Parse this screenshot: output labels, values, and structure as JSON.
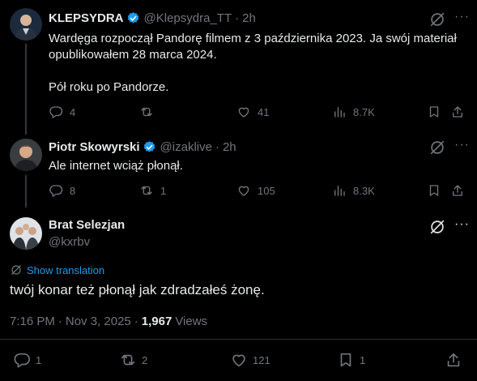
{
  "tweets": [
    {
      "name": "KLEPSYDRA",
      "handle": "@Klepsydra_TT",
      "time": "2h",
      "lines": [
        "Wardęga rozpoczął Pandorę filmem z 3 października 2023. Ja swój materiał",
        "opublikowałem 28 marca 2024."
      ],
      "line3": "Pół roku po Pandorze.",
      "replies": "4",
      "reposts": "",
      "likes": "41",
      "views": "8.7K"
    },
    {
      "name": "Piotr Skowyrski",
      "handle": "@izaklive",
      "time": "2h",
      "text": "Ale internet wciąż płonął.",
      "replies": "8",
      "reposts": "1",
      "likes": "105",
      "views": "8.3K"
    }
  ],
  "main": {
    "name": "Brat Selezjan",
    "handle": "@kxrbv",
    "translate_label": "Show translation",
    "text": "twój konar też płonął jak zdradzałeś żonę.",
    "time": "7:16 PM",
    "date": "Nov 3, 2025",
    "views_count": "1,967",
    "views_label": "Views",
    "replies": "1",
    "reposts": "2",
    "likes": "121",
    "bookmarks": "1"
  },
  "separator_dot": "·",
  "more_glyph": "···",
  "colors": {
    "background": "#000000",
    "text": "#e7e9ea",
    "muted": "#71767b",
    "link": "#1d9bf0",
    "verified": "#1d9bf0"
  },
  "icons": [
    "grok-icon",
    "more-icon",
    "reply-icon",
    "repost-icon",
    "like-icon",
    "views-icon",
    "bookmark-icon",
    "share-icon",
    "verified-icon",
    "translate-icon"
  ]
}
